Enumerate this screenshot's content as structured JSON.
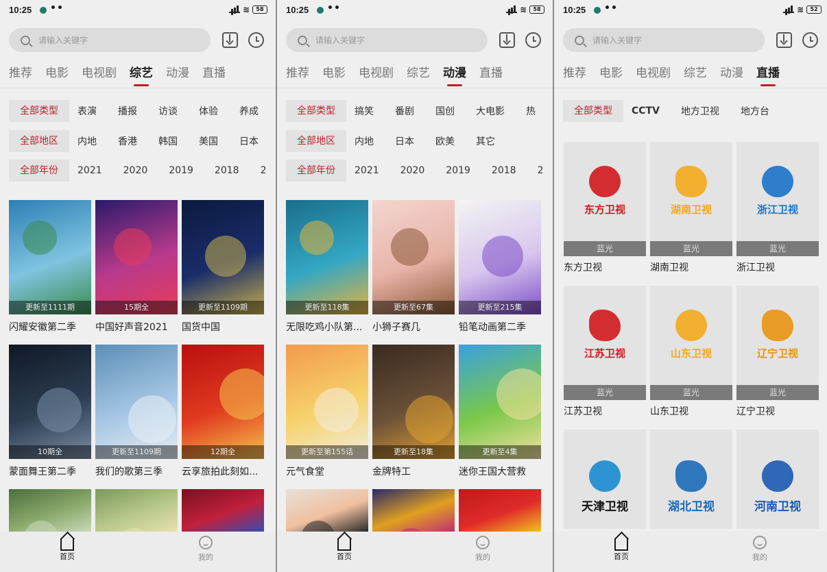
{
  "status": {
    "time": "10:25",
    "battery": "58",
    "battery3": "52"
  },
  "search": {
    "placeholder": "请输入关键字"
  },
  "tabs": [
    "推荐",
    "电影",
    "电视剧",
    "综艺",
    "动漫",
    "直播"
  ],
  "panels": [
    {
      "active_tab": 3,
      "filters": [
        {
          "chip": "全部类型",
          "options": [
            "表演",
            "播报",
            "访谈",
            "体验",
            "养成"
          ]
        },
        {
          "chip": "全部地区",
          "options": [
            "内地",
            "香港",
            "韩国",
            "美国",
            "日本"
          ]
        },
        {
          "chip": "全部年份",
          "options": [
            "2021",
            "2020",
            "2019",
            "2018",
            "2"
          ]
        }
      ],
      "items": [
        {
          "title": "闪耀安徽第二季",
          "badge": "更新至1111期",
          "colors": [
            "#2d7fb5",
            "#7fc3e0",
            "#3a8c4c"
          ]
        },
        {
          "title": "中国好声音2021",
          "badge": "15期全",
          "colors": [
            "#2a1a6a",
            "#b93a8c",
            "#e83b57"
          ]
        },
        {
          "title": "国货中国",
          "badge": "更新至1109期",
          "colors": [
            "#0b1a3e",
            "#1a2d6a",
            "#c9b14c"
          ]
        },
        {
          "title": "蒙面舞王第二季",
          "badge": "10期全",
          "colors": [
            "#101824",
            "#2c3d52",
            "#7a8ea5"
          ]
        },
        {
          "title": "我们的歌第三季",
          "badge": "更新至1109期",
          "colors": [
            "#5b8fb8",
            "#a6c6e4",
            "#e8eef4"
          ]
        },
        {
          "title": "云享旅拍此刻如...",
          "badge": "12期全",
          "colors": [
            "#b80f0f",
            "#e03b1f",
            "#f6c24c"
          ]
        },
        {
          "title": "",
          "badge": "",
          "colors": [
            "#4b6f3d",
            "#89a86a",
            "#c8d9b9"
          ]
        },
        {
          "title": "",
          "badge": "",
          "colors": [
            "#7a9a5a",
            "#b8c88a",
            "#e8e0b0"
          ]
        },
        {
          "title": "",
          "badge": "",
          "colors": [
            "#7a1020",
            "#c0203a",
            "#3a4ab0"
          ]
        }
      ]
    },
    {
      "active_tab": 4,
      "filters": [
        {
          "chip": "全部类型",
          "options": [
            "搞笑",
            "番剧",
            "国创",
            "大电影",
            "热"
          ]
        },
        {
          "chip": "全部地区",
          "options": [
            "内地",
            "日本",
            "欧美",
            "其它"
          ]
        },
        {
          "chip": "全部年份",
          "options": [
            "2021",
            "2020",
            "2019",
            "2018",
            "2"
          ]
        }
      ],
      "items": [
        {
          "title": "无限吃鸡小队第...",
          "badge": "更新至118集",
          "colors": [
            "#1a6e8a",
            "#33a7c4",
            "#e6b33a"
          ]
        },
        {
          "title": "小狮子赛几",
          "badge": "更新至67集",
          "colors": [
            "#f3d5d0",
            "#e8b4a8",
            "#8a5a3a"
          ]
        },
        {
          "title": "铅笔动画第二季",
          "badge": "更新至215集",
          "colors": [
            "#f3f3f3",
            "#d8c6ee",
            "#7c4ec8"
          ]
        },
        {
          "title": "元气食堂",
          "badge": "更新至第155话",
          "colors": [
            "#f39a4c",
            "#f6d26a",
            "#f2ece0"
          ]
        },
        {
          "title": "金牌特工",
          "badge": "更新至18集",
          "colors": [
            "#3a2a20",
            "#6a5038",
            "#e0a030"
          ]
        },
        {
          "title": "迷你王国大营救",
          "badge": "更新至4集",
          "colors": [
            "#3aa0e0",
            "#7ac84a",
            "#f2e0a0"
          ]
        },
        {
          "title": "",
          "badge": "",
          "colors": [
            "#e8e0d8",
            "#f0c0a0",
            "#2a2a2a"
          ]
        },
        {
          "title": "",
          "badge": "",
          "colors": [
            "#2a2a6a",
            "#e0a020",
            "#c03070"
          ]
        },
        {
          "title": "",
          "badge": "",
          "colors": [
            "#c01a1a",
            "#e02a2a",
            "#f0c020"
          ]
        }
      ]
    },
    {
      "active_tab": 5,
      "filters": [
        {
          "chip": "全部类型",
          "options": [
            "CCTV",
            "地方卫视",
            "地方台"
          ]
        }
      ],
      "channels": [
        {
          "name": "东方卫视",
          "quality": "蓝光",
          "logo": "东方卫视",
          "color": "#d0181e",
          "logo_icon": "star-red"
        },
        {
          "name": "湖南卫视",
          "quality": "蓝光",
          "logo": "湖南卫视",
          "color": "#f3a81c",
          "logo_icon": "hunan"
        },
        {
          "name": "浙江卫视",
          "quality": "蓝光",
          "logo": "浙江卫视",
          "color": "#1a72c8",
          "logo_icon": "zhejiang"
        },
        {
          "name": "江苏卫视",
          "quality": "蓝光",
          "logo": "江苏卫视",
          "color": "#d0181e",
          "logo_icon": "jiangsu"
        },
        {
          "name": "山东卫视",
          "quality": "蓝光",
          "logo": "山东卫视",
          "color": "#f3a81c",
          "logo_icon": "shandong"
        },
        {
          "name": "辽宁卫视",
          "quality": "蓝光",
          "logo": "辽宁卫视",
          "color": "#e89410",
          "logo_icon": "liaoning"
        },
        {
          "name": "",
          "quality": "",
          "logo": "天津卫视",
          "color": "#1a8ad0",
          "logo_icon": "tianjin"
        },
        {
          "name": "",
          "quality": "",
          "logo": "湖北卫视",
          "color": "#1a6ab8",
          "logo_icon": "hubei"
        },
        {
          "name": "",
          "quality": "",
          "logo": "河南卫视",
          "color": "#1a5ab0",
          "logo_icon": "henan"
        }
      ]
    }
  ],
  "nav": {
    "home": "首页",
    "me": "我的"
  }
}
